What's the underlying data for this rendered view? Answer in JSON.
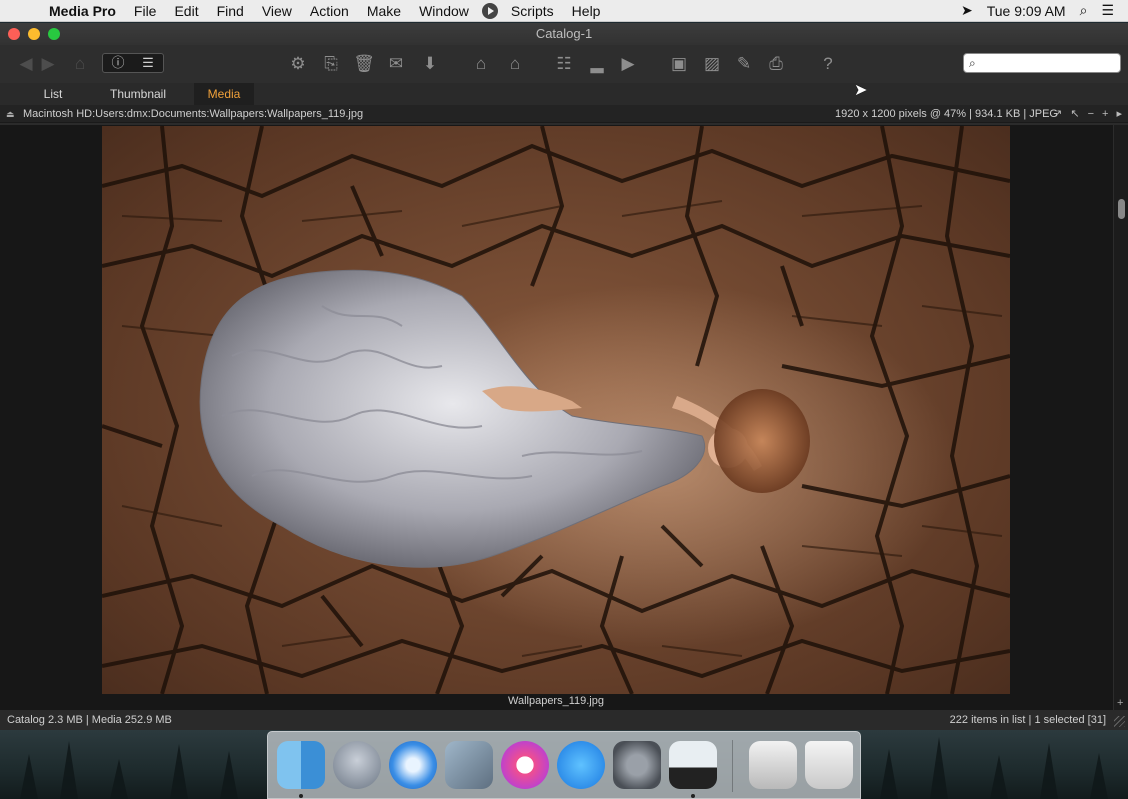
{
  "menubar": {
    "app_name": "Media Pro",
    "items": [
      "File",
      "Edit",
      "Find",
      "View",
      "Action",
      "Make",
      "Window",
      "Scripts",
      "Help"
    ],
    "clock": "Tue 9:09 AM"
  },
  "window": {
    "title": "Catalog-1"
  },
  "tabs": [
    "List",
    "Thumbnail",
    "Media"
  ],
  "active_tab": "Media",
  "pathbar": {
    "path": "Macintosh HD:Users:dmx:Documents:Wallpapers:Wallpapers_119.jpg",
    "info": "1920 x 1200 pixels @ 47%  |  934.1 KB  |  JPEG"
  },
  "viewer": {
    "caption": "Wallpapers_119.jpg"
  },
  "statusbar": {
    "left": "Catalog  2.3 MB  |  Media 252.9 MB",
    "right": "222 items in list  |  1 selected [31]"
  },
  "search": {
    "placeholder": ""
  },
  "dock": [
    "Finder",
    "Launchpad",
    "Safari",
    "Preview",
    "iTunes",
    "App Store",
    "System Preferences",
    "Media Pro",
    "Downloads",
    "Trash"
  ],
  "colors": {
    "active_tab": "#f0a13a",
    "window_bg": "#2b2b2b",
    "viewer_bg": "#171717"
  }
}
